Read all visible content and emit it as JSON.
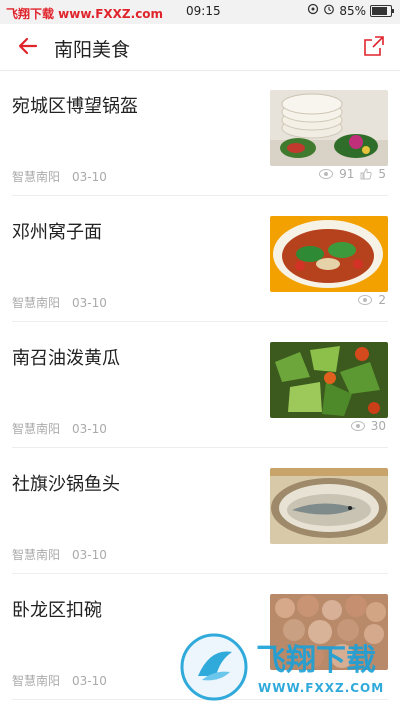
{
  "statusbar": {
    "left": "飞翔下载 www.FXXZ.com",
    "time": "09:15",
    "battery": "85%",
    "battery_level": 0.85
  },
  "header": {
    "title": "南阳美食"
  },
  "items": [
    {
      "title": "宛城区博望锅盔",
      "source": "智慧南阳",
      "date": "03-10",
      "views": "91",
      "likes": "5"
    },
    {
      "title": "邓州窝子面",
      "source": "智慧南阳",
      "date": "03-10",
      "views": "2"
    },
    {
      "title": "南召油泼黄瓜",
      "source": "智慧南阳",
      "date": "03-10",
      "views": "30"
    },
    {
      "title": "社旗沙锅鱼头",
      "source": "智慧南阳",
      "date": "03-10"
    },
    {
      "title": "卧龙区扣碗",
      "source": "智慧南阳",
      "date": "03-10"
    }
  ],
  "watermark": {
    "text": "飞翔下载",
    "url": "WWW.FXXZ.COM"
  },
  "colors": {
    "accent": "#e0242c",
    "watermark": "#1aa0d8"
  }
}
